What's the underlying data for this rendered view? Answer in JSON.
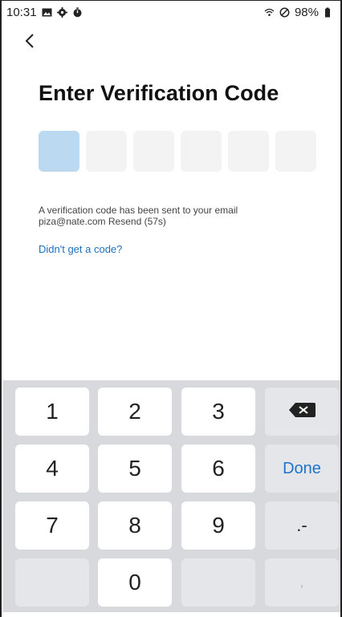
{
  "status_bar": {
    "time": "10:31",
    "battery": "98%"
  },
  "header": {
    "title": "Enter Verification Code"
  },
  "code": {
    "digit_count": 6,
    "active_index": 0
  },
  "info": {
    "line1": "A verification code has been sent to your email",
    "line2": "piza@nate.com Resend (57s)"
  },
  "help": {
    "link_text": "Didn't get a code?"
  },
  "keyboard": {
    "keys": {
      "k1": "1",
      "k2": "2",
      "k3": "3",
      "k4": "4",
      "k5": "5",
      "k6": "6",
      "k7": "7",
      "k8": "8",
      "k9": "9",
      "k0": "0",
      "done": "Done",
      "dot_dash": ".-",
      "comma": ","
    },
    "accent_color": "#1e74c9"
  },
  "colors": {
    "active_box": "#bcd9f2",
    "link": "#1e6fbf"
  }
}
